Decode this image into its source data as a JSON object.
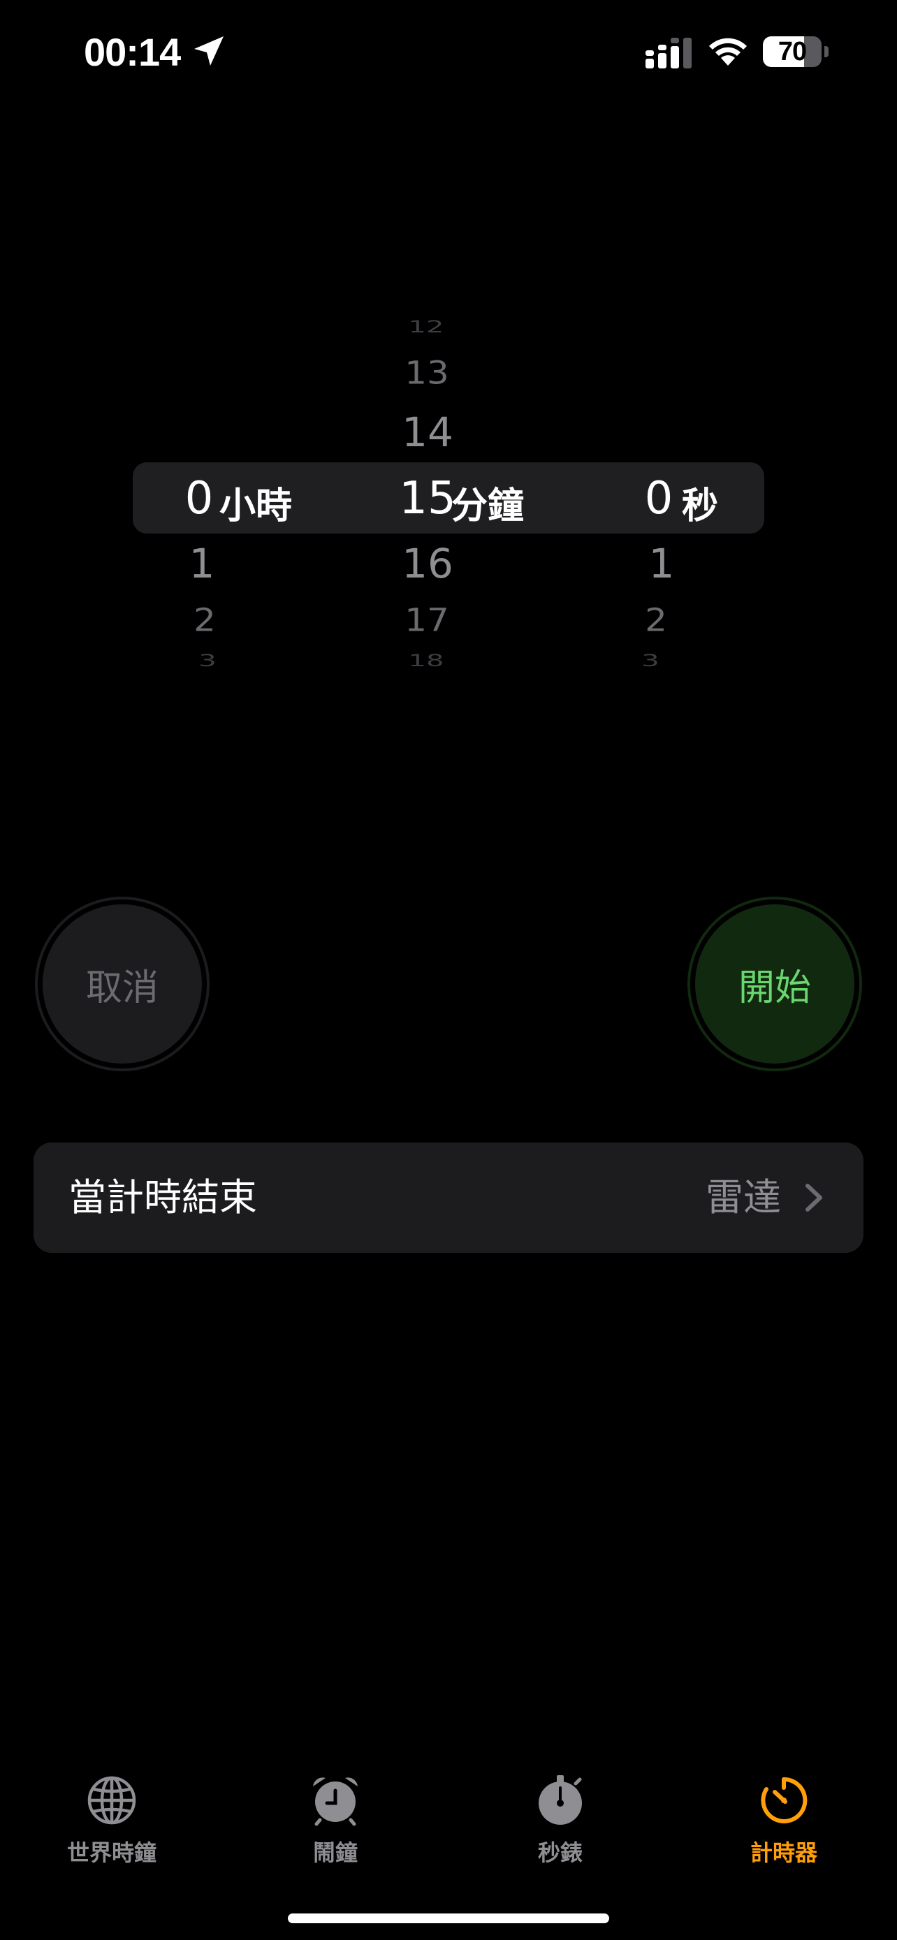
{
  "status_bar": {
    "time": "00:14",
    "battery_level": "70",
    "battery_fraction": 0.7,
    "icons": [
      "location-arrow-icon",
      "cellular-signal-icon",
      "wifi-icon",
      "battery-icon"
    ]
  },
  "picker": {
    "hours": {
      "above": [
        "",
        "",
        ""
      ],
      "selected": "0",
      "below": [
        "1",
        "2",
        "3"
      ],
      "unit": "小時"
    },
    "minutes": {
      "above": [
        "12",
        "13",
        "14"
      ],
      "selected": "15",
      "below": [
        "16",
        "17",
        "18"
      ],
      "unit": "分鐘"
    },
    "seconds": {
      "above": [
        "",
        "",
        ""
      ],
      "selected": "0",
      "below": [
        "1",
        "2",
        "3"
      ],
      "unit": "秒"
    }
  },
  "buttons": {
    "cancel": "取消",
    "start": "開始"
  },
  "timer_end": {
    "label": "當計時結束",
    "value": "雷達",
    "chevron": "chevron-right-icon"
  },
  "tab_bar": {
    "tabs": [
      {
        "label": "世界時鐘",
        "icon": "globe-icon",
        "active": false
      },
      {
        "label": "鬧鐘",
        "icon": "alarm-clock-icon",
        "active": false
      },
      {
        "label": "秒錶",
        "icon": "stopwatch-icon",
        "active": false
      },
      {
        "label": "計時器",
        "icon": "timer-icon",
        "active": true
      }
    ]
  },
  "colors": {
    "background": "#000000",
    "accent_orange": "#ff9f0a",
    "start_green": "#6ad66f",
    "start_bg": "#11290f",
    "secondary_gray": "#8e8e93",
    "cell_bg": "#1c1c1e"
  }
}
